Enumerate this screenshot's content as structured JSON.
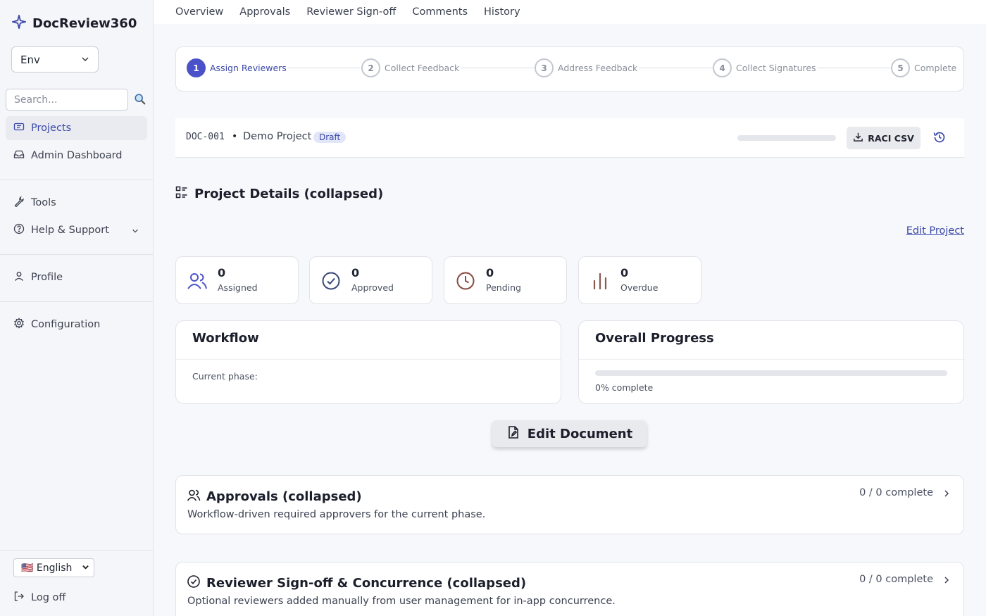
{
  "app": {
    "title": "DocReview360",
    "brand_color": "#3c49a8"
  },
  "sidebar": {
    "env_label": "Env",
    "search_placeholder": "Search...",
    "items": [
      {
        "label": "Projects",
        "icon": "ticket-icon"
      },
      {
        "label": "Admin Dashboard",
        "icon": "inbox-icon"
      },
      {
        "label": "Tools",
        "icon": "wrench-icon"
      },
      {
        "label": "Help & Support",
        "icon": "help-circle-icon"
      },
      {
        "label": "Profile",
        "icon": "user-icon"
      },
      {
        "label": "Configuration",
        "icon": "gear-icon"
      }
    ],
    "language": "🇺🇸 English",
    "logout": "Log off"
  },
  "topnav": {
    "tabs": [
      "Overview",
      "Approvals",
      "Reviewer Sign-off",
      "Comments",
      "History"
    ]
  },
  "stepper": {
    "steps": [
      {
        "num": "1",
        "label": "Assign Reviewers"
      },
      {
        "num": "2",
        "label": "Collect Feedback"
      },
      {
        "num": "3",
        "label": "Address Feedback"
      },
      {
        "num": "4",
        "label": "Collect Signatures"
      },
      {
        "num": "5",
        "label": "Complete"
      }
    ]
  },
  "doc": {
    "id": "DOC-001",
    "separator": "•",
    "project": "Demo Project",
    "status": "Draft",
    "progress": 0,
    "raci_label": "RACI CSV"
  },
  "details": {
    "title": "Project Details (collapsed)",
    "edit_link": "Edit Project"
  },
  "stats": [
    {
      "value": "0",
      "label": "Assigned",
      "color": "#4b52c9"
    },
    {
      "value": "0",
      "label": "Approved",
      "color": "#3a4a7a"
    },
    {
      "value": "0",
      "label": "Pending",
      "color": "#8a4a3e"
    },
    {
      "value": "0",
      "label": "Overdue",
      "color": "#8a5a4e"
    }
  ],
  "workflow": {
    "title": "Workflow",
    "phase_label": "Current phase:"
  },
  "overall": {
    "title": "Overall Progress",
    "percent": 0,
    "text": "0% complete"
  },
  "edit_document": "Edit Document",
  "approvals": {
    "title": "Approvals (collapsed)",
    "desc": "Workflow-driven required approvers for the current phase.",
    "count": "0 / 0 complete"
  },
  "signoff": {
    "title": "Reviewer Sign-off & Concurrence (collapsed)",
    "desc": "Optional reviewers added manually from user management for in-app concurrence.",
    "count": "0 / 0 complete"
  }
}
